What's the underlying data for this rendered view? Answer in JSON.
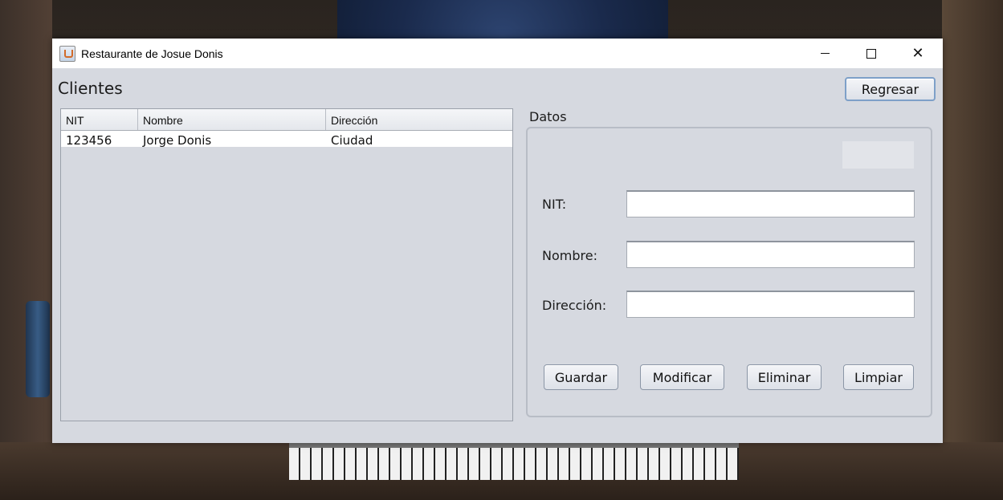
{
  "window": {
    "title": "Restaurante de Josue Donis",
    "controls": {
      "minimize": "minimize-icon",
      "maximize": "maximize-icon",
      "close": "close-icon"
    }
  },
  "header": {
    "section_title": "Clientes",
    "back_button": "Regresar"
  },
  "table": {
    "columns": [
      "NIT",
      "Nombre",
      "Dirección"
    ],
    "rows": [
      [
        "123456",
        "Jorge Donis",
        "Ciudad"
      ]
    ]
  },
  "form": {
    "group_label": "Datos",
    "id_value": "",
    "fields": {
      "nit": {
        "label": "NIT:",
        "value": ""
      },
      "nombre": {
        "label": "Nombre:",
        "value": ""
      },
      "direccion": {
        "label": "Dirección:",
        "value": ""
      }
    },
    "buttons": {
      "guardar": "Guardar",
      "modificar": "Modificar",
      "eliminar": "Eliminar",
      "limpiar": "Limpiar"
    }
  },
  "colors": {
    "window_bg": "#d6d9e0",
    "accent_border": "#7ea0c8"
  }
}
